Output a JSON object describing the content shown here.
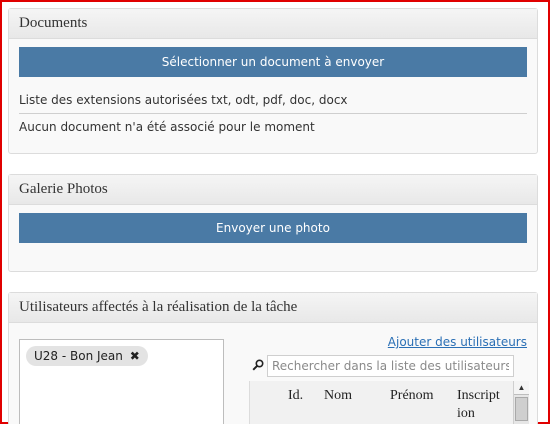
{
  "documents": {
    "title": "Documents",
    "upload_button": "Sélectionner un document à envoyer",
    "extensions_text": "Liste des extensions autorisées txt, odt, pdf, doc, docx",
    "empty_text": "Aucun document n'a été associé pour le moment"
  },
  "gallery": {
    "title": "Galerie Photos",
    "upload_button": "Envoyer une photo"
  },
  "users": {
    "title": "Utilisateurs affectés à la réalisation de la tâche",
    "assigned": [
      {
        "label": "U28 - Bon Jean",
        "remove_icon": "✖"
      }
    ],
    "add_link": "Ajouter des utilisateurs",
    "search": {
      "icon": "magnifier-icon",
      "placeholder": "Rechercher dans la liste des utilisateurs",
      "value": ""
    },
    "table": {
      "columns": [
        "Id.",
        "Nom",
        "Prénom",
        "Inscript",
        "ion"
      ]
    }
  },
  "colors": {
    "button_bg": "#4a7aa5",
    "link": "#2a6fb5",
    "frame_border": "#e00000"
  }
}
